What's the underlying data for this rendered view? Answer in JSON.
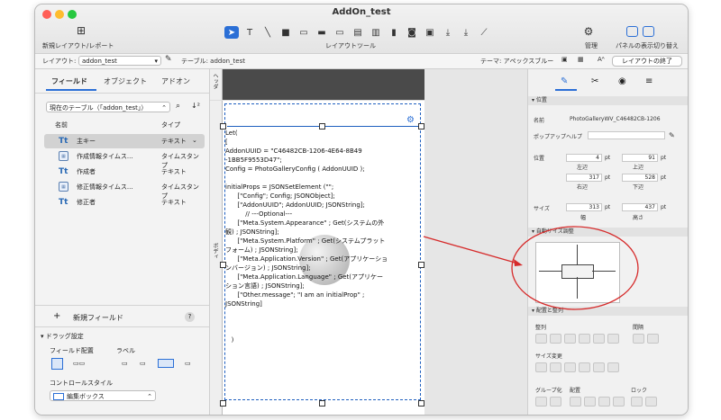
{
  "window": {
    "title": "AddOn_test",
    "new_layout_label": "新規レイアウト/レポート",
    "layout_tools_label": "レイアウトツール",
    "manage_label": "管理",
    "panel_toggle_label": "パネルの表示切り替え",
    "tools": [
      "pointer-tool-icon",
      "text-tool-icon",
      "line-tool-icon",
      "shape-tool-icon",
      "field-tool-icon",
      "button-tool-icon",
      "popover-tool-icon",
      "portal-tool-icon",
      "tab-tool-icon",
      "chart-tool-icon",
      "web-viewer-tool-icon",
      "slide-tool-icon",
      "insert-field-icon",
      "insert-picture-icon",
      "format-painter-icon"
    ]
  },
  "layoutbar": {
    "layout_label": "レイアウト:",
    "layout_value": "addon_test",
    "table_label": "テーブル: addon_test",
    "theme_label": "テーマ: アペックスブルー",
    "exit_button": "レイアウトの終了"
  },
  "left_panel": {
    "tabs": [
      "フィールド",
      "オブジェクト",
      "アドオン"
    ],
    "table_selector": "現在のテーブル（「addon_test」）",
    "columns": {
      "name": "名前",
      "type": "タイプ"
    },
    "fields": [
      {
        "name": "主キー",
        "type": "テキスト",
        "kind": "text",
        "selected": true
      },
      {
        "name": "作成情報タイムス...",
        "type": "タイムスタンプ",
        "kind": "timestamp",
        "selected": false
      },
      {
        "name": "作成者",
        "type": "テキスト",
        "kind": "text",
        "selected": false
      },
      {
        "name": "修正情報タイムス...",
        "type": "タイムスタンプ",
        "kind": "timestamp",
        "selected": false
      },
      {
        "name": "修正者",
        "type": "テキスト",
        "kind": "text",
        "selected": false
      }
    ],
    "new_field": "新規フィールド",
    "help": "?",
    "drag_settings": "ドラッグ設定",
    "field_placement": "フィールド配置",
    "label": "ラベル",
    "control_style": "コントロールスタイル",
    "control_style_value": "編集ボックス"
  },
  "canvas": {
    "header_part": "ヘッダ",
    "body_part": "ボディ",
    "code_lines": [
      "Let(",
      "[",
      "AddonUUID = \"C46482CB-1206-4E64-8B49",
      "-1BB5F9553D47\";",
      "Config = PhotoGalleryConfig ( AddonUUID );",
      "",
      "initialProps = JSONSetElement (\"\";",
      "      [\"Config\"; Config; JSONObject];",
      "      [\"AddonUUID\"; AddonUUID; JSONString];",
      "          // ---Optional---",
      "      [\"Meta.System.Appearance\" ; Get(システムの外",
      "観) ; JSONString];",
      "      [\"Meta.System.Platform\" ; Get(システムプラット",
      "フォーム) ; JSONString];",
      "      [\"Meta.Application.Version\" ; Get(アプリケーショ",
      "ンバージョン) ; JSONString];",
      "      [\"Meta.Application.Language\" ; Get(アプリケー",
      "ション言語) ; JSONString];",
      "      [\"Other.message\"; \"I am an initialProp\" ;",
      "JSONString]",
      "",
      "",
      "",
      "   )"
    ]
  },
  "inspector": {
    "section_position": "位置",
    "name_label": "名前",
    "name_value": "PhotoGalleryWV_C46482CB-1206",
    "popover_help_label": "ポップアップヘルプ",
    "position_label": "位置",
    "left": "4",
    "top": "91",
    "right": "317",
    "bottom": "528",
    "left_label": "左辺",
    "top_label": "上辺",
    "right_label": "右辺",
    "bottom_label": "下辺",
    "unit": "pt",
    "size_label": "サイズ",
    "width": "313",
    "height": "437",
    "width_label": "幅",
    "height_label": "高さ",
    "section_autosize": "自動サイズ調整",
    "section_arrange": "配置と整列",
    "arrange_label": "整列",
    "spacing_label": "間隔",
    "resize_label": "サイズ変更",
    "group_label": "グループ化",
    "arrange2_label": "配置",
    "lock_label": "ロック"
  },
  "colors": {
    "accent": "#2b6fd6",
    "annotation": "#d62a2a",
    "selection": "#1e5fbf"
  }
}
